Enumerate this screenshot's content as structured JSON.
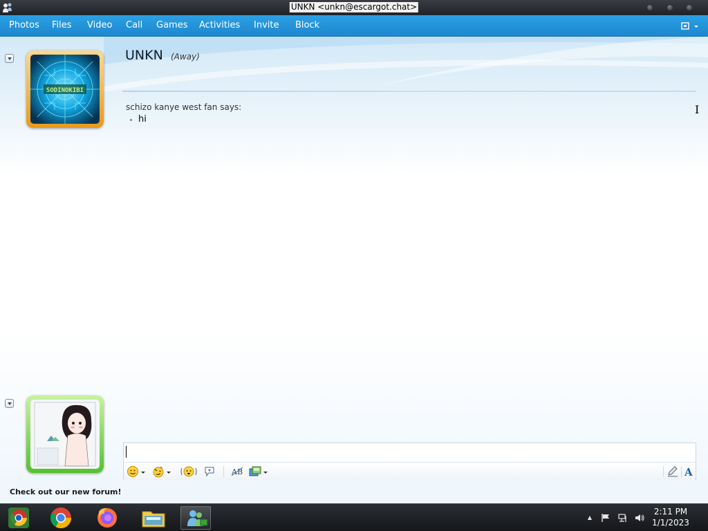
{
  "window": {
    "title": "UNKN <unkn@escargot.chat>"
  },
  "menu": {
    "items": [
      "Photos",
      "Files",
      "Video",
      "Call",
      "Games",
      "Activities",
      "Invite",
      "Block"
    ]
  },
  "contact": {
    "name": "UNKN",
    "status": "(Away)",
    "avatar_text": "SODINOKIBI"
  },
  "messages": [
    {
      "sender": "schizo kanye west fan says:",
      "text": "hi"
    }
  ],
  "compose": {
    "value": "",
    "promo_text": "Check out our new forum!"
  },
  "toolbar": {
    "icons": [
      "emoticon-icon",
      "wink-icon",
      "nudge-icon",
      "voice-clip-icon",
      "handwriting-ab-icon",
      "background-icon",
      "pen-icon",
      "font-icon"
    ]
  },
  "taskbar": {
    "apps": [
      "chromium-icon",
      "chrome-icon",
      "firefox-icon",
      "file-explorer-icon",
      "messenger-icon"
    ],
    "clock": {
      "time": "2:11 PM",
      "date": "1/1/2023"
    }
  },
  "colors": {
    "menu_bar": "#1d87cf",
    "contact_frame": "#e89a1a",
    "user_frame": "#53c22c",
    "taskbar": "#15171a"
  }
}
